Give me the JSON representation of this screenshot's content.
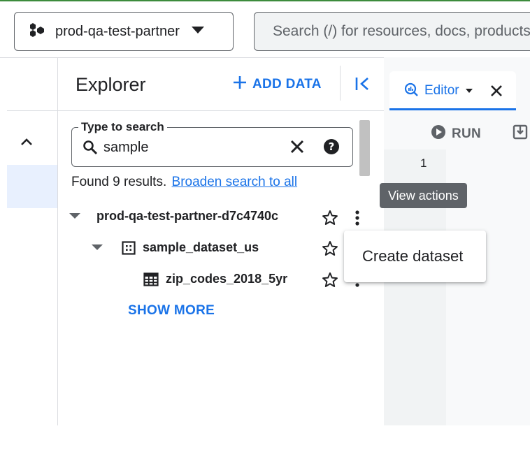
{
  "header": {
    "project": {
      "label": "prod-qa-test-partner",
      "icon": "project-hexagons-icon"
    },
    "search": {
      "placeholder": "Search (/) for resources, docs, products"
    }
  },
  "explorer": {
    "title": "Explorer",
    "add_data_label": "ADD DATA",
    "search": {
      "legend": "Type to search",
      "value": "sample"
    },
    "results": {
      "found_text": "Found 9 results.",
      "broaden_link": "Broaden search to all"
    },
    "tree": [
      {
        "level": 0,
        "label": "prod-qa-test-partner-d7c4740c",
        "type": "project",
        "expanded": true,
        "starred": false
      },
      {
        "level": 1,
        "label": "sample_dataset_us",
        "type": "dataset",
        "expanded": true,
        "starred": false
      },
      {
        "level": 2,
        "label": "zip_codes_2018_5yr",
        "type": "table",
        "starred": false
      }
    ],
    "show_more_label": "SHOW MORE"
  },
  "editor": {
    "tab_label": "Editor",
    "run_label": "RUN",
    "line_numbers": [
      "1"
    ]
  },
  "tooltip": {
    "text": "View actions"
  },
  "context_menu": {
    "items": [
      "Create dataset"
    ]
  },
  "colors": {
    "accent": "#1a73e8",
    "text": "#202124",
    "muted": "#5f6368",
    "tooltip_bg": "#5f6368",
    "top_bar": "#3c8b3c"
  }
}
